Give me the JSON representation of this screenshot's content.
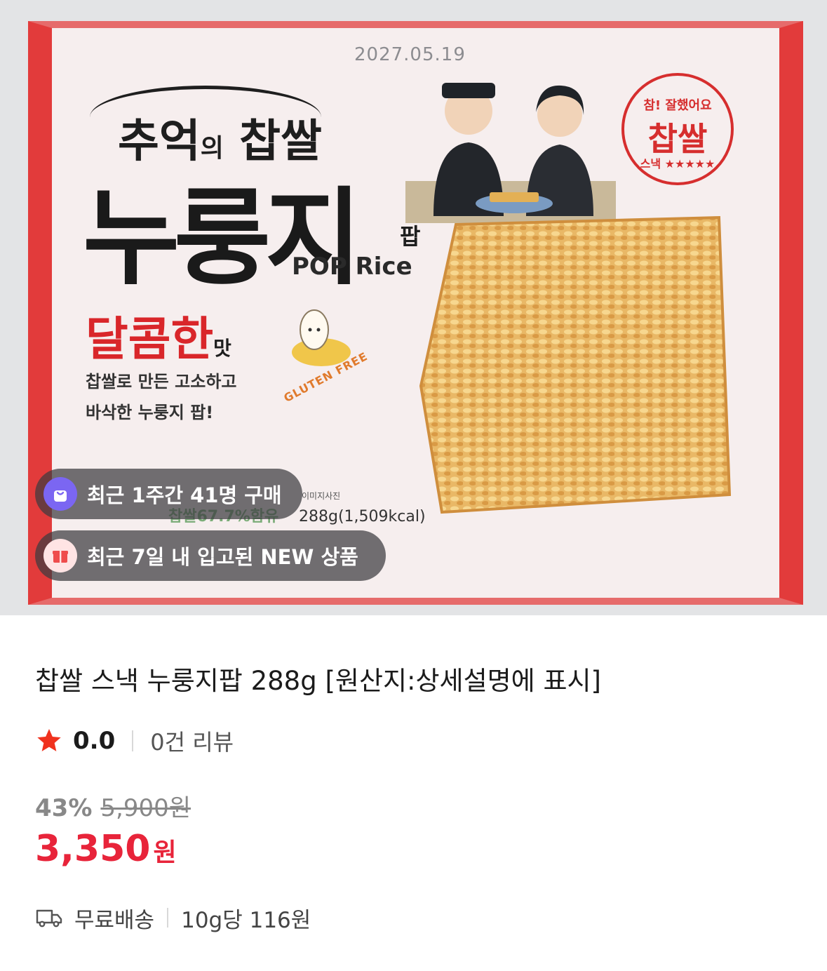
{
  "product_image": {
    "pack_date": "2027.05.19",
    "brand_line1_a": "추억",
    "brand_line1_b": "의",
    "brand_line1_c": " 찹쌀",
    "brand_line2": "누룽지",
    "brand_pap": "팝",
    "pop_rice": "POP Rice",
    "flavor_main": "달콤한",
    "flavor_small": "맛",
    "desc_line1": "찹쌀로 만든 고소하고",
    "desc_line2": "바삭한 누룽지 팝!",
    "gluten_free": "GLUTEN FREE",
    "seal_top": "참! 잘했어요",
    "seal_mid": "찹쌀",
    "seal_bot": "스낵 ★★★★★",
    "image_note": "이미지사진",
    "ghost_label": "찹쌀67.7%함유",
    "net_weight": "288g(1,509kcal)"
  },
  "badges": [
    {
      "text": "최근 1주간 41명 구매",
      "icon": "shopping-bag-icon",
      "icon_bg": "#7b66f2"
    },
    {
      "text": "최근 7일 내 입고된 NEW 상품",
      "icon": "gift-icon",
      "icon_bg": "#ffe4e4"
    }
  ],
  "product": {
    "title": "찹쌀 스낵 누룽지팝 288g [원산지:상세설명에 표시]",
    "rating": "0.0",
    "review_count": "0건 리뷰",
    "discount_rate": "43%",
    "original_price": "5,900원",
    "sale_price": "3,350",
    "price_unit": "원",
    "shipping": "무료배송",
    "unit_price": "10g당 116원"
  },
  "colors": {
    "accent_red": "#e8243a",
    "star": "#f0321e",
    "badge_purple": "#7b66f2"
  }
}
